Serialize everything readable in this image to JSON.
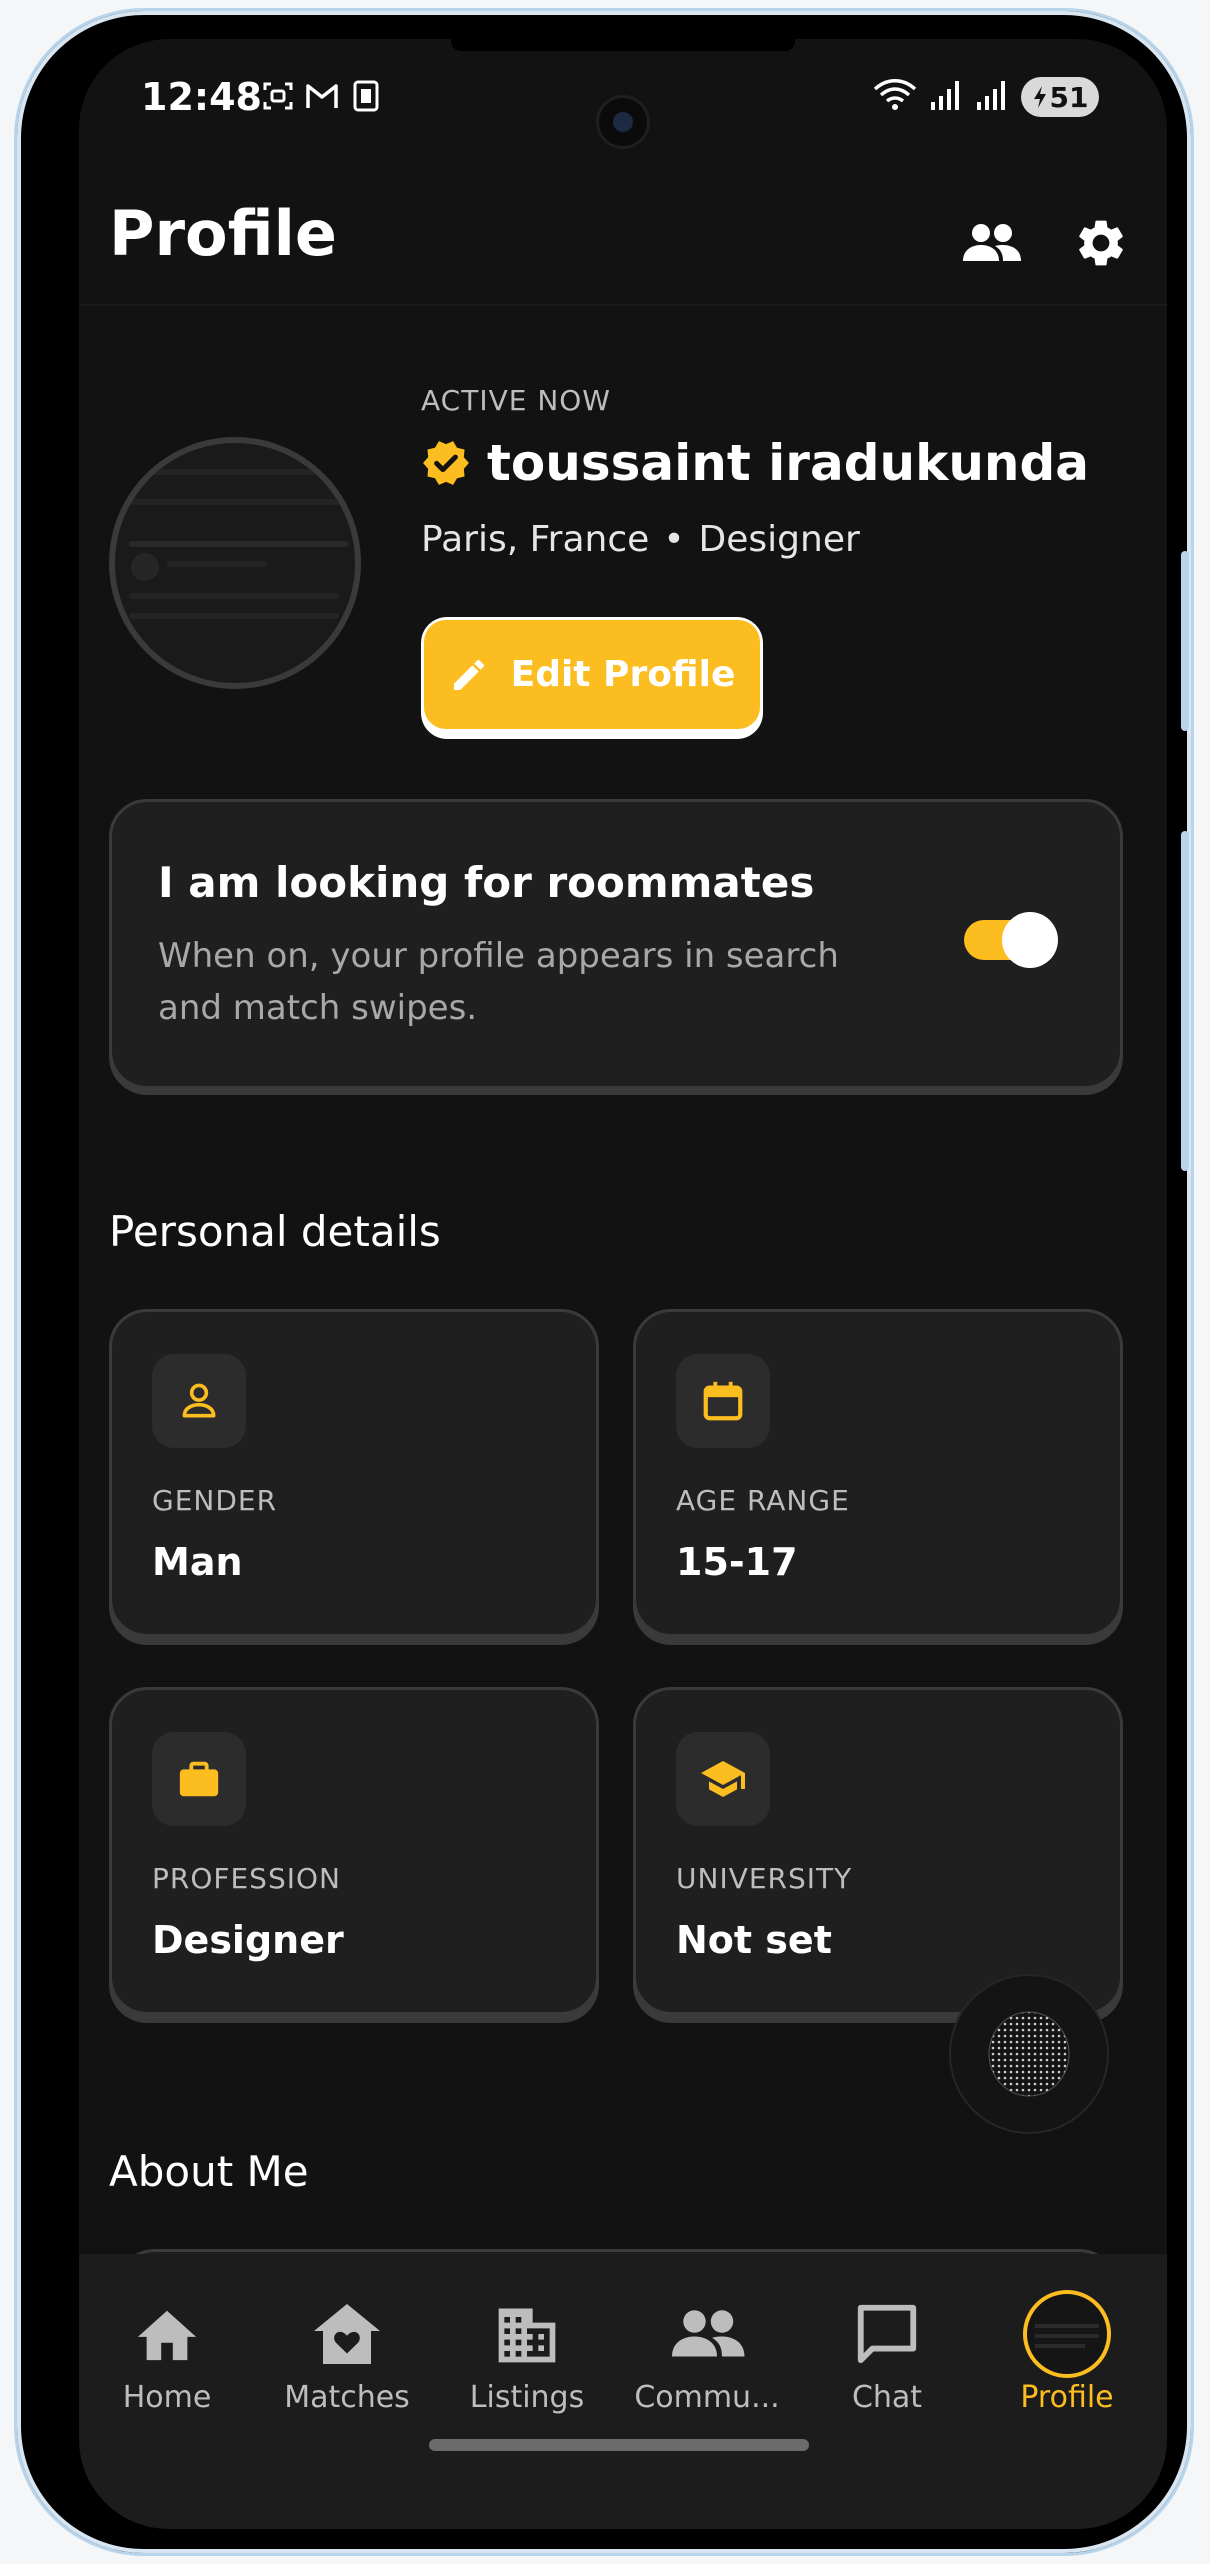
{
  "colors": {
    "accent": "#fbbd1f",
    "background": "#121212",
    "card": "#1f1f1f",
    "border": "#3a3a3a"
  },
  "status_bar": {
    "time": "12:48",
    "battery": "51",
    "icons": [
      "screenshot-icon",
      "gmail-icon",
      "sim-icon",
      "wifi-icon",
      "signal-icon",
      "signal-icon",
      "battery-charging-icon"
    ]
  },
  "header": {
    "title": "Profile",
    "actions": [
      "people-icon",
      "settings-gear-icon"
    ]
  },
  "profile": {
    "status": "ACTIVE NOW",
    "name": "toussaint iradukunda",
    "location": "Paris, France",
    "separator": "•",
    "occupation": "Designer",
    "edit_button": "Edit Profile"
  },
  "looking_card": {
    "title": "I am looking for roommates",
    "description": "When on, your profile appears in search and match swipes.",
    "toggle_on": true
  },
  "personal_details": {
    "title": "Personal details",
    "items": [
      {
        "label": "GENDER",
        "value": "Man",
        "icon": "person-icon"
      },
      {
        "label": "AGE RANGE",
        "value": "15-17",
        "icon": "calendar-icon"
      },
      {
        "label": "PROFESSION",
        "value": "Designer",
        "icon": "briefcase-icon"
      },
      {
        "label": "UNIVERSITY",
        "value": "Not set",
        "icon": "graduation-cap-icon"
      }
    ]
  },
  "about": {
    "title": "About Me"
  },
  "bottom_nav": {
    "items": [
      {
        "label": "Home",
        "icon": "home-icon"
      },
      {
        "label": "Matches",
        "icon": "house-heart-icon"
      },
      {
        "label": "Listings",
        "icon": "building-icon"
      },
      {
        "label": "Commu...",
        "icon": "community-icon"
      },
      {
        "label": "Chat",
        "icon": "chat-icon"
      },
      {
        "label": "Profile",
        "icon": "profile-avatar-icon",
        "active": true
      }
    ]
  }
}
